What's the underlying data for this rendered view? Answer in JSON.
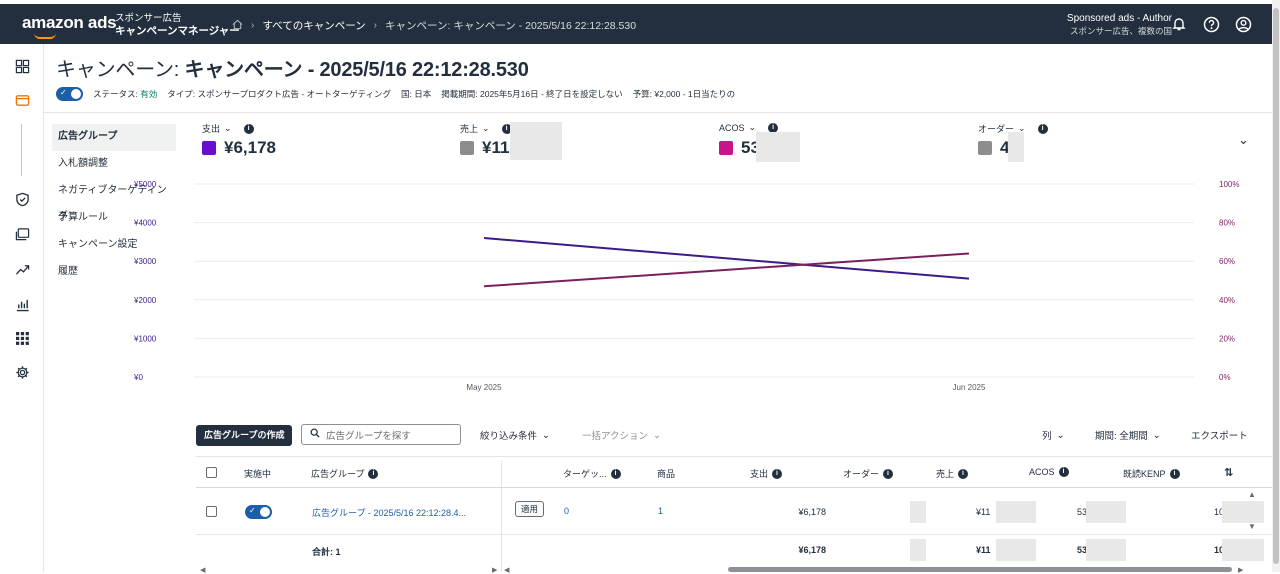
{
  "topbar": {
    "logo": "amazon ads",
    "product_line1": "スポンサー広告",
    "product_line2": "キャンペーンマネージャー",
    "breadcrumb_all": "すべてのキャンペーン",
    "breadcrumb_current": "キャンペーン: キャンペーン - 2025/5/16 22:12:28.530",
    "account_name": "Sponsored ads - Author",
    "account_sub": "スポンサー広告、複数の国"
  },
  "page": {
    "title_prefix": "キャンペーン:",
    "title_name": "キャンペーン - 2025/5/16 22:12:28.530",
    "status_label": "ステータス:",
    "status_value": "有効",
    "type": "タイプ: スポンサープロダクト広告 - オートターゲティング",
    "country": "国: 日本",
    "period": "掲載期間: 2025年5月16日 - 終了日を設定しない",
    "budget": "予算: ¥2,000 - 1日当たりの"
  },
  "left_nav": [
    "広告グループ",
    "入札額調整",
    "ネガティブターゲティング",
    "予算ルール",
    "キャンペーン設定",
    "履歴"
  ],
  "metrics": [
    {
      "label": "支出",
      "value": "¥6,178",
      "color": "#6a0dce"
    },
    {
      "label": "売上",
      "value": "¥11",
      "color": "#8d8d8d"
    },
    {
      "label": "ACOS",
      "value": "53",
      "color": "#c7148a"
    },
    {
      "label": "オーダー",
      "value": "4",
      "color": "#8d8d8d"
    }
  ],
  "chart_data": {
    "type": "line",
    "x": [
      "May 2025",
      "Jun 2025"
    ],
    "y_left_ticks": [
      "¥0",
      "¥1000",
      "¥2000",
      "¥3000",
      "¥4000",
      "¥5000"
    ],
    "y_right_ticks": [
      "0%",
      "20%",
      "40%",
      "60%",
      "80%",
      "100%"
    ],
    "ylim_left": [
      0,
      5000
    ],
    "ylim_right": [
      0,
      100
    ],
    "series": [
      {
        "axis": "left",
        "color": "#3c1a8a",
        "values": [
          3600,
          2550
        ]
      },
      {
        "axis": "right",
        "color": "#7a1f5c",
        "values": [
          47,
          64
        ]
      }
    ],
    "grid": true
  },
  "toolbar": {
    "create": "広告グループの作成",
    "search_placeholder": "広告グループを探す",
    "filter": "絞り込み条件",
    "bulk": "一括アクション",
    "columns": "列",
    "period": "期間: 全期間",
    "export": "エクスポート"
  },
  "table": {
    "headers": {
      "active": "実施中",
      "group": "広告グループ",
      "targets": "ターゲッ...",
      "products": "商品",
      "spend": "支出",
      "orders": "オーダー",
      "sales": "売上",
      "acos": "ACOS",
      "kenp": "既読KENP"
    },
    "row": {
      "group": "広告グループ - 2025/5/16 22:12:28.4...",
      "badge": "適用",
      "targets": "0",
      "products": "1",
      "spend": "¥6,178",
      "sales": "¥11",
      "acos": "53",
      "kenp": "10"
    },
    "total": {
      "label": "合計: 1",
      "spend": "¥6,178",
      "sales": "¥11",
      "acos": "53",
      "kenp": "10"
    }
  }
}
